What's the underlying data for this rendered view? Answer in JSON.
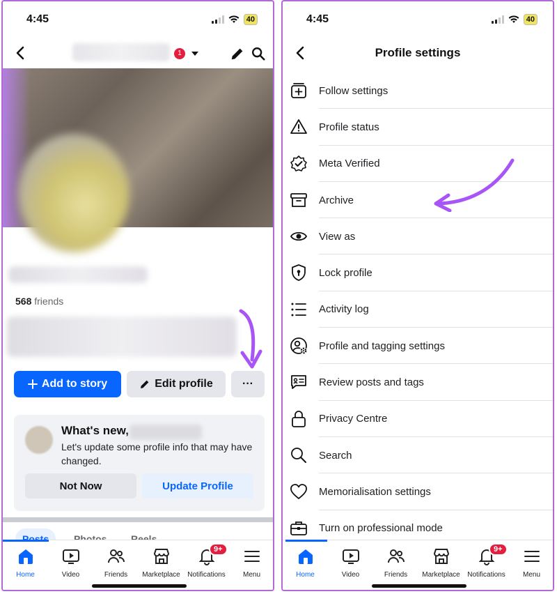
{
  "left": {
    "status": {
      "time": "4:45",
      "battery": "40"
    },
    "header": {
      "badge_count": "1"
    },
    "friends_count": "568",
    "friends_label": " friends",
    "buttons": {
      "add_story": "Add to story",
      "edit_profile": "Edit profile",
      "more": "···"
    },
    "card": {
      "title": "What's new,",
      "text": "Let's update some profile info that may have changed.",
      "not_now": "Not Now",
      "update": "Update Profile"
    },
    "profile_tabs": [
      "Posts",
      "Photos",
      "Reels"
    ]
  },
  "right": {
    "status": {
      "time": "4:45",
      "battery": "40"
    },
    "title": "Profile settings",
    "items": [
      {
        "label": "Follow settings",
        "icon": "follow-settings-icon"
      },
      {
        "label": "Profile status",
        "icon": "warning-icon"
      },
      {
        "label": "Meta Verified",
        "icon": "verified-badge-icon"
      },
      {
        "label": "Archive",
        "icon": "archive-box-icon"
      },
      {
        "label": "View as",
        "icon": "eye-icon"
      },
      {
        "label": "Lock profile",
        "icon": "shield-lock-icon"
      },
      {
        "label": "Activity log",
        "icon": "list-icon"
      },
      {
        "label": "Profile and tagging settings",
        "icon": "person-gear-icon"
      },
      {
        "label": "Review posts and tags",
        "icon": "review-tag-icon"
      },
      {
        "label": "Privacy Centre",
        "icon": "padlock-icon"
      },
      {
        "label": "Search",
        "icon": "search-icon"
      },
      {
        "label": "Memorialisation settings",
        "icon": "heart-icon"
      },
      {
        "label": "Turn on professional mode",
        "icon": "briefcase-icon"
      }
    ]
  },
  "nav": {
    "items": [
      {
        "label": "Home",
        "icon": "home-icon"
      },
      {
        "label": "Video",
        "icon": "video-icon"
      },
      {
        "label": "Friends",
        "icon": "friends-icon"
      },
      {
        "label": "Marketplace",
        "icon": "marketplace-icon"
      },
      {
        "label": "Notifications",
        "icon": "bell-icon"
      },
      {
        "label": "Menu",
        "icon": "menu-icon"
      }
    ],
    "notifications_badge": "9+"
  },
  "colors": {
    "accent": "#0866ff",
    "highlight_arrow": "#a855f7",
    "badge": "#e41e3f",
    "border": "#b06ad8"
  }
}
